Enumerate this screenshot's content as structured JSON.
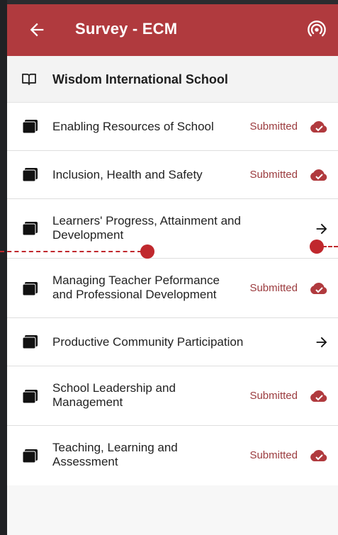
{
  "appbar": {
    "title": "Survey - ECM",
    "back_icon": "arrow-left-icon",
    "sync_icon": "broadcast-icon",
    "color": "#b03a3e"
  },
  "school": {
    "icon": "book-open-icon",
    "name": "Wisdom International School"
  },
  "items": [
    {
      "label_line1": "Enabling Resources of School",
      "label_line2": "",
      "status": "Submitted",
      "action_icon": "cloud-check-icon"
    },
    {
      "label_line1": "Inclusion, Health and Safety",
      "label_line2": "",
      "status": "Submitted",
      "action_icon": "cloud-check-icon"
    },
    {
      "label_line1": "Learners' Progress, Attainment and",
      "label_line2": "Development",
      "status": "",
      "action_icon": "arrow-right-icon"
    },
    {
      "label_line1": "Managing Teacher Peformance",
      "label_line2": "and Professional Development",
      "status": "Submitted",
      "action_icon": "cloud-check-icon"
    },
    {
      "label_line1": "Productive Community Participation",
      "label_line2": "",
      "status": "",
      "action_icon": "arrow-right-icon"
    },
    {
      "label_line1": "School Leadership and",
      "label_line2": "Management",
      "status": "Submitted",
      "action_icon": "cloud-check-icon"
    },
    {
      "label_line1": "Teaching, Learning and",
      "label_line2": "Assessment",
      "status": "Submitted",
      "action_icon": "cloud-check-icon"
    }
  ],
  "colors": {
    "status_text": "#9b3b3e",
    "annotation": "#c0282d"
  }
}
